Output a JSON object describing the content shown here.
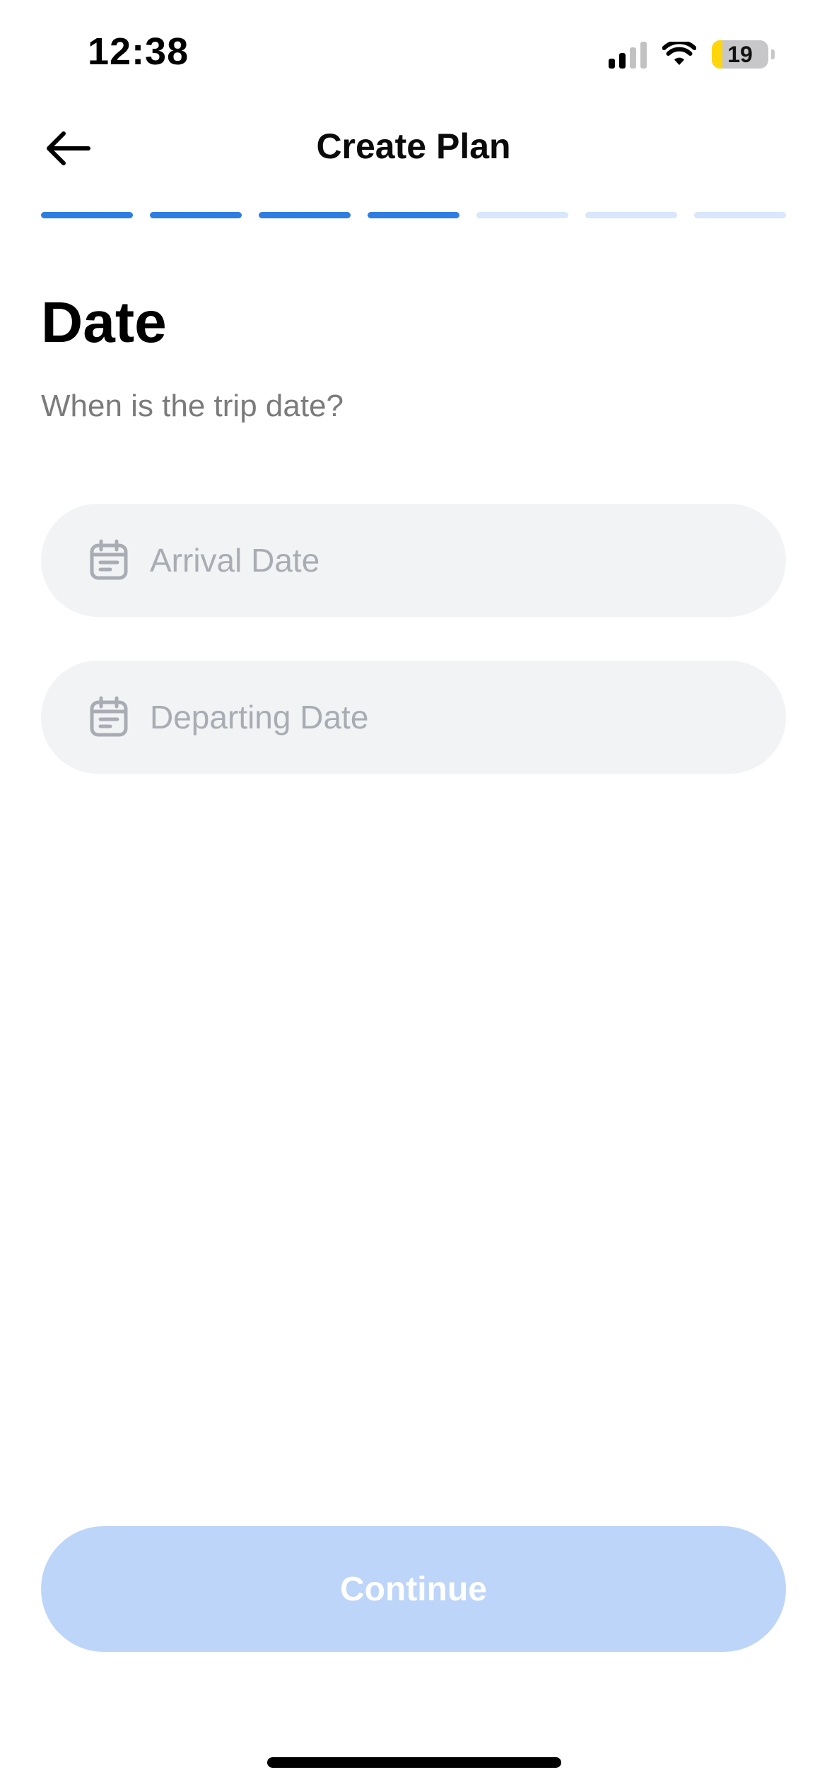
{
  "status_bar": {
    "time": "12:38",
    "battery_level": 19,
    "battery_label": "19",
    "signal_bars_active": 2,
    "signal_bars_total": 4
  },
  "header": {
    "title": "Create Plan",
    "back_icon": "arrow-left-icon"
  },
  "progress": {
    "total_steps": 7,
    "completed_steps": 4,
    "active_color": "#2f7de1",
    "inactive_color": "#d9e6fb"
  },
  "content": {
    "title": "Date",
    "subtitle": "When is the trip date?"
  },
  "fields": {
    "arrival": {
      "placeholder": "Arrival Date",
      "value": "",
      "icon": "calendar-icon"
    },
    "departing": {
      "placeholder": "Departing Date",
      "value": "",
      "icon": "calendar-icon"
    }
  },
  "footer": {
    "continue_label": "Continue",
    "continue_enabled": false,
    "continue_color": "#bdd5f8"
  }
}
